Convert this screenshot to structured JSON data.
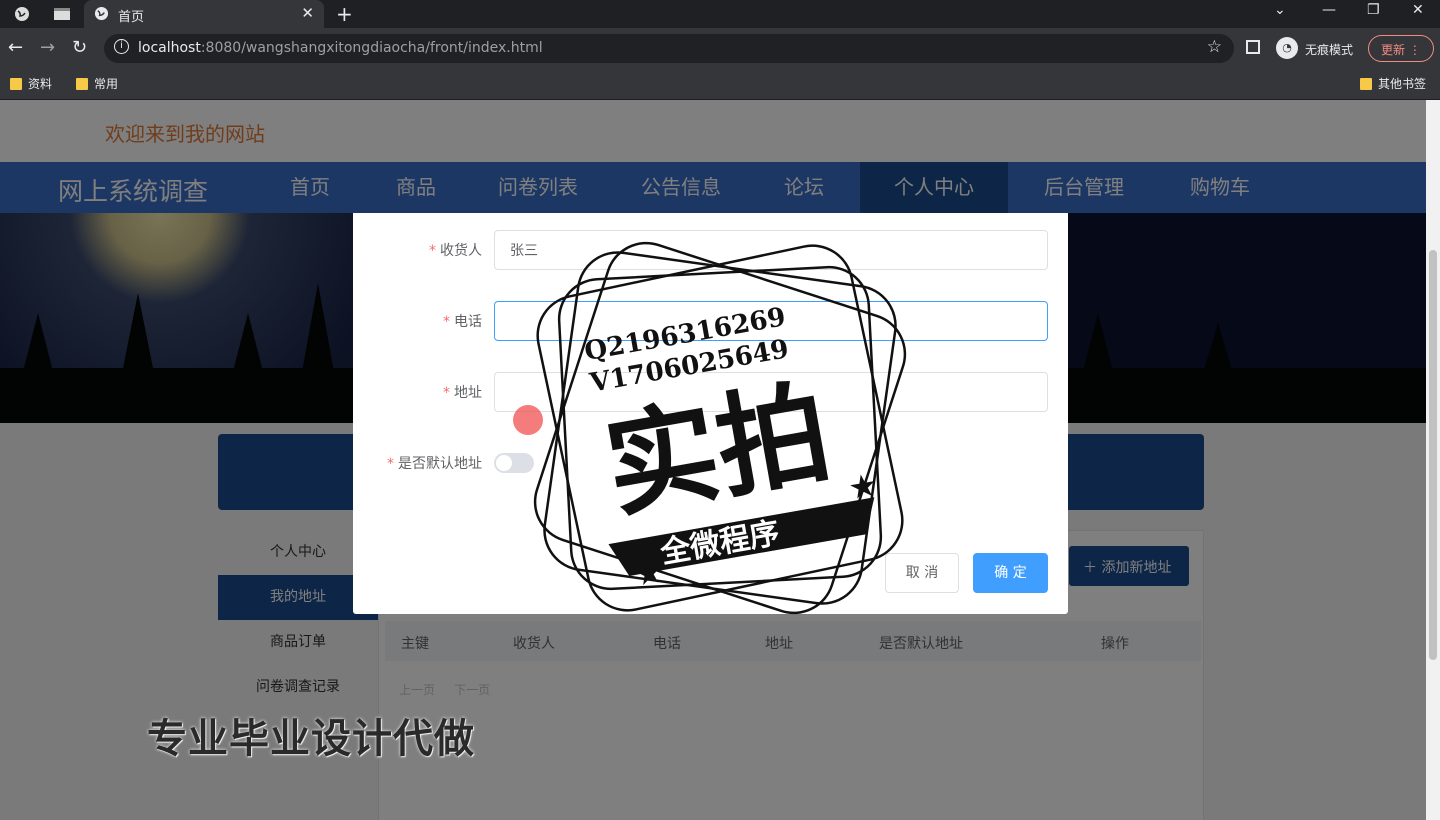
{
  "browser": {
    "tab_title": "首页",
    "url_host": "localhost",
    "url_rest": ":8080/wangshangxitongdiaocha/front/index.html",
    "incognito_label": "无痕模式",
    "update_label": "更新",
    "bookmarks": [
      "资料",
      "常用"
    ],
    "other_bookmarks": "其他书签"
  },
  "site": {
    "welcome": "欢迎来到我的网站",
    "brand": "网上系统调查",
    "nav": [
      "首页",
      "商品",
      "问卷列表",
      "公告信息",
      "论坛",
      "个人中心",
      "后台管理",
      "购物车"
    ],
    "active_nav": "个人中心"
  },
  "sidebar": {
    "items": [
      "个人中心",
      "我的地址",
      "商品订单",
      "问卷调查记录"
    ]
  },
  "address_panel": {
    "add_button": "添加新地址",
    "columns": [
      "主键",
      "收货人",
      "电话",
      "地址",
      "是否默认地址",
      "操作"
    ],
    "pager": [
      "上一页",
      "下一页"
    ]
  },
  "dialog": {
    "fields": [
      {
        "label": "收货人",
        "value": "张三",
        "required": true
      },
      {
        "label": "电话",
        "value": "",
        "required": true
      },
      {
        "label": "地址",
        "value": "",
        "required": true
      }
    ],
    "default_label": "是否默认地址",
    "default_on": false,
    "cancel": "取 消",
    "confirm": "确 定"
  },
  "watermark": {
    "qq": "Q2196316269",
    "vx": "V1706025649",
    "big": "实拍",
    "ribbon": "全微程序",
    "bottom": "专业毕业设计代做"
  },
  "colors": {
    "nav_bg": "#3a6fc8",
    "nav_active": "#1a4d8f",
    "welcome": "#e07b39",
    "primary": "#409eff"
  }
}
